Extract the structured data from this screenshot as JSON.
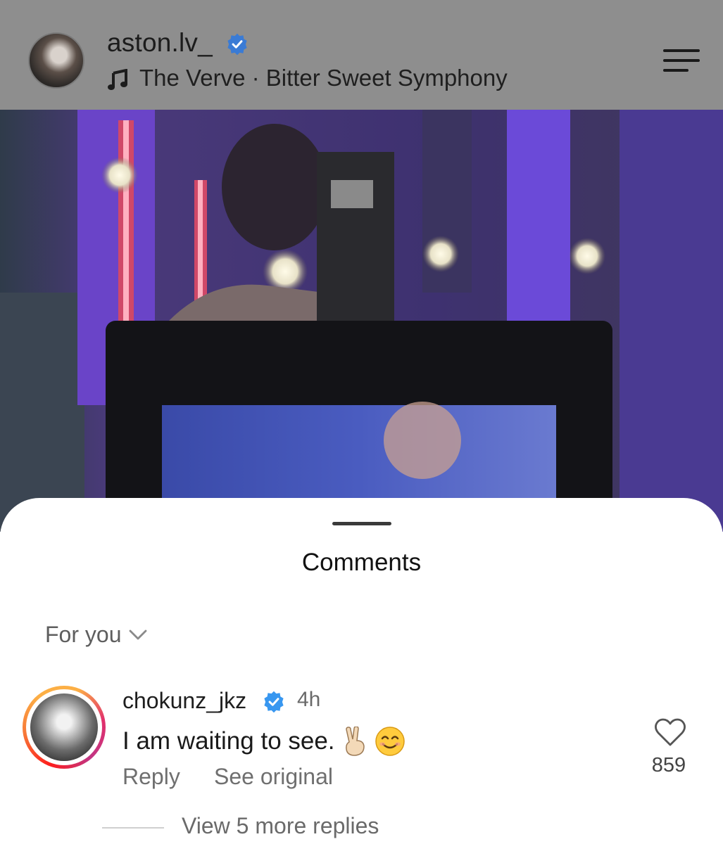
{
  "header": {
    "username": "aston.lv_",
    "verified": true,
    "song": "The Verve · Bitter Sweet Symphony",
    "icons": {
      "avatar": "profile-avatar",
      "verified": "verified-badge-icon",
      "music": "music-note-icon",
      "menu": "menu-icon"
    }
  },
  "sheet": {
    "title": "Comments",
    "sort_label": "For you"
  },
  "comment": {
    "username": "chokunz_jkz",
    "verified": true,
    "time": "4h",
    "text": "I am waiting to see.",
    "emojis": [
      "victory-hand",
      "smiling-face"
    ],
    "reply_label": "Reply",
    "see_original_label": "See original",
    "likes": "859",
    "view_replies_label": "View 5 more replies"
  },
  "colors": {
    "accent_verified": "#3897f0",
    "header_overlay": "#8e8e8e",
    "text_secondary": "#6f6f6f"
  }
}
